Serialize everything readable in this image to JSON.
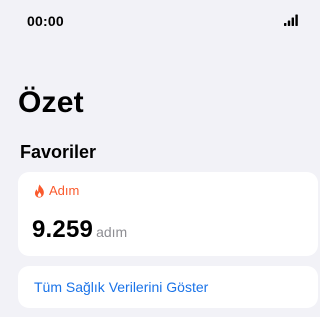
{
  "status_bar": {
    "time": "00:00"
  },
  "page": {
    "title": "Özet"
  },
  "favorites": {
    "title": "Favoriler",
    "steps_card": {
      "icon": "flame-icon",
      "label": "Adım",
      "value": "9.259",
      "unit": "adım"
    }
  },
  "show_all": {
    "label": "Tüm Sağlık Verilerini Göster"
  },
  "colors": {
    "background": "#f2f2f7",
    "card": "#ffffff",
    "accent_orange": "#fa5a2d",
    "link_blue": "#1a73e8",
    "secondary_text": "#8e8e93"
  }
}
